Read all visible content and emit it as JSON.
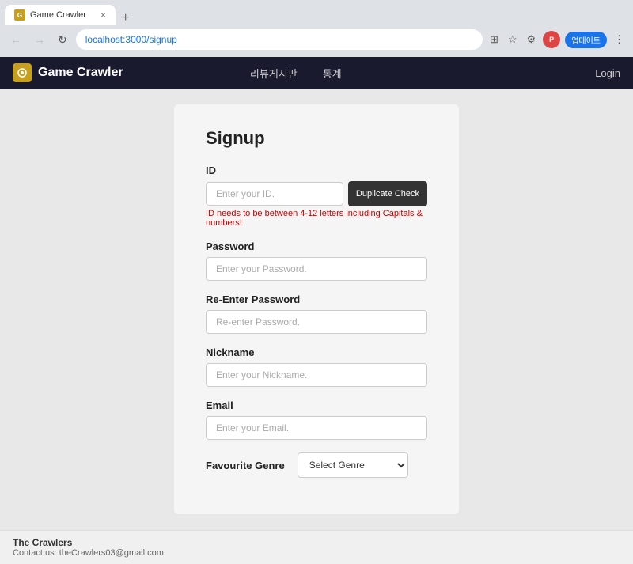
{
  "browser": {
    "tab_title": "Game Crawler",
    "tab_close": "×",
    "tab_new": "+",
    "url": "localhost:3000/signup",
    "back_btn": "←",
    "forward_btn": "→",
    "reload_btn": "↻",
    "update_label": "업데이트",
    "more_btn": "⋮"
  },
  "nav": {
    "logo_text": "Game Crawler",
    "logo_icon": "G",
    "links": [
      {
        "label": "리뷰게시판"
      },
      {
        "label": "통계"
      }
    ],
    "login": "Login"
  },
  "form": {
    "title": "Signup",
    "id_label": "ID",
    "id_placeholder": "Enter your ID.",
    "id_error": "ID needs to be between 4-12 letters including Capitals & numbers!",
    "duplicate_btn": "Duplicate Check",
    "password_label": "Password",
    "password_placeholder": "Enter your Password.",
    "repassword_label": "Re-Enter Password",
    "repassword_placeholder": "Re-enter Password.",
    "nickname_label": "Nickname",
    "nickname_placeholder": "Enter your Nickname.",
    "email_label": "Email",
    "email_placeholder": "Enter your Email.",
    "genre_label": "Favourite Genre",
    "genre_placeholder": "Select Genre"
  },
  "footer": {
    "company": "The Crawlers",
    "contact": "Contact us: theCrawlers03@gmail.com"
  }
}
